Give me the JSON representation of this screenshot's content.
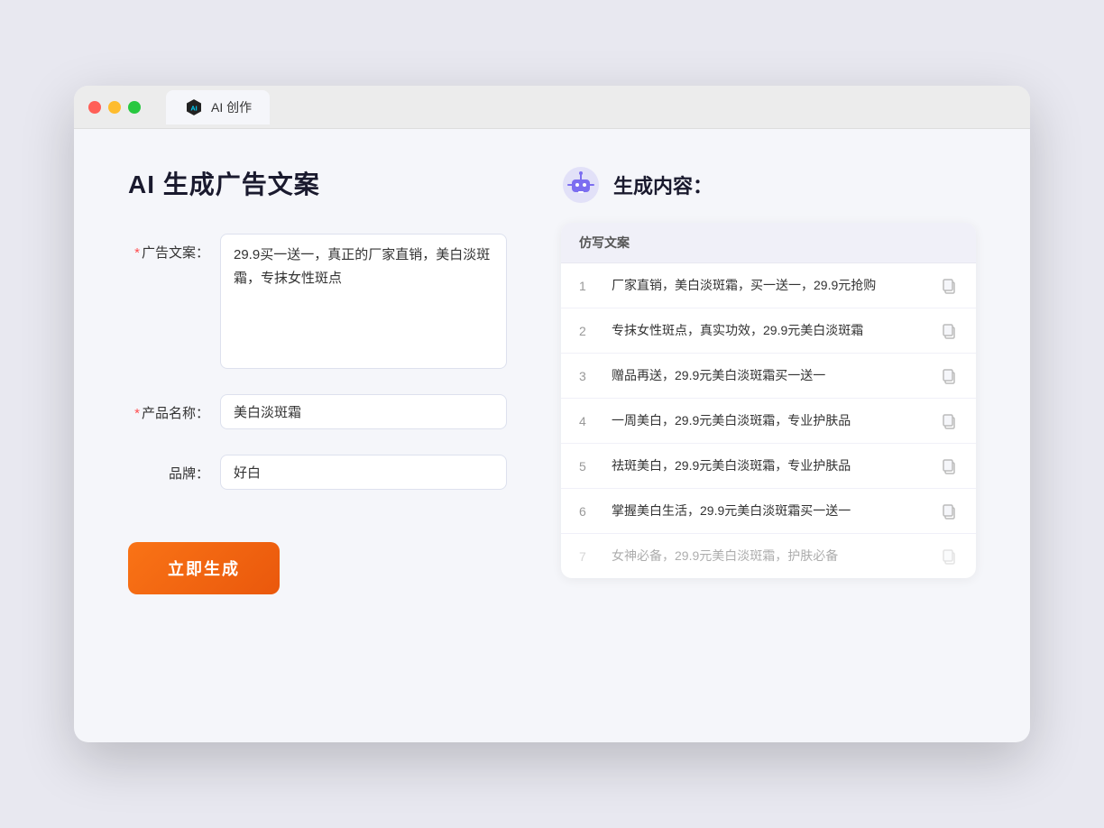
{
  "browser": {
    "tab_label": "AI 创作"
  },
  "left_panel": {
    "title": "AI 生成广告文案",
    "fields": [
      {
        "id": "ad_copy",
        "label": "广告文案：",
        "required": true,
        "type": "textarea",
        "value": "29.9买一送一，真正的厂家直销，美白淡斑霜，专抹女性斑点"
      },
      {
        "id": "product_name",
        "label": "产品名称：",
        "required": true,
        "type": "input",
        "value": "美白淡斑霜"
      },
      {
        "id": "brand",
        "label": "品牌：",
        "required": false,
        "type": "input",
        "value": "好白"
      }
    ],
    "generate_button": "立即生成",
    "required_star": "*"
  },
  "right_panel": {
    "title": "生成内容：",
    "column_header": "仿写文案",
    "results": [
      {
        "number": "1",
        "text": "厂家直销，美白淡斑霜，买一送一，29.9元抢购",
        "dimmed": false
      },
      {
        "number": "2",
        "text": "专抹女性斑点，真实功效，29.9元美白淡斑霜",
        "dimmed": false
      },
      {
        "number": "3",
        "text": "赠品再送，29.9元美白淡斑霜买一送一",
        "dimmed": false
      },
      {
        "number": "4",
        "text": "一周美白，29.9元美白淡斑霜，专业护肤品",
        "dimmed": false
      },
      {
        "number": "5",
        "text": "祛斑美白，29.9元美白淡斑霜，专业护肤品",
        "dimmed": false
      },
      {
        "number": "6",
        "text": "掌握美白生活，29.9元美白淡斑霜买一送一",
        "dimmed": false
      },
      {
        "number": "7",
        "text": "女神必备，29.9元美白淡斑霜，护肤必备",
        "dimmed": true
      }
    ]
  }
}
